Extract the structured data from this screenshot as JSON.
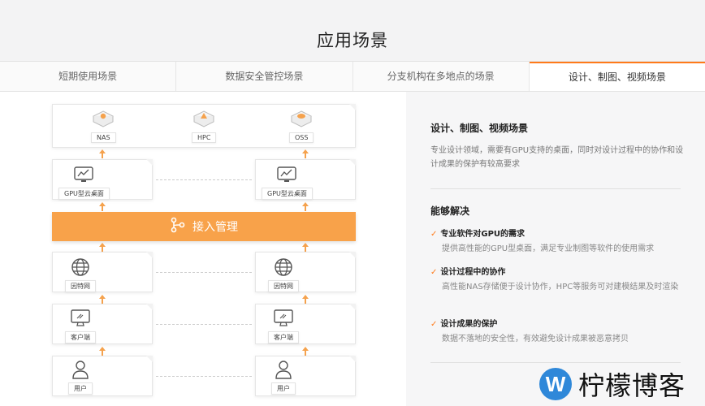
{
  "page": {
    "title": "应用场景"
  },
  "tabs": [
    {
      "label": "短期使用场景"
    },
    {
      "label": "数据安全管控场景"
    },
    {
      "label": "分支机构在多地点的场景"
    },
    {
      "label": "设计、制图、视频场景",
      "active": true
    }
  ],
  "diagram": {
    "storage": {
      "nas": "NAS",
      "hpc": "HPC",
      "oss": "OSS"
    },
    "gpu_left": "GPU型云桌面",
    "gpu_right": "GPU型云桌面",
    "access": "接入管理",
    "internet_left": "因特网",
    "internet_right": "因特网",
    "client_left": "客户端",
    "client_right": "客户端",
    "user_left": "用户",
    "user_right": "用户",
    "colors": {
      "accent": "#ff7a1a",
      "banner": "#f8a24a",
      "arrow": "#f5a24d"
    }
  },
  "panel": {
    "heading": "设计、制图、视频场景",
    "description": "专业设计领域，需要有GPU支持的桌面，同时对设计过程中的协作和设计成果的保护有较高要求",
    "solve_heading": "能够解决",
    "items": [
      {
        "title": "专业软件对GPU的需求",
        "text": "提供高性能的GPU型桌面，满足专业制图等软件的使用需求"
      },
      {
        "title": "设计过程中的协作",
        "text": "高性能NAS存储便于设计协作，HPC等服务可对建模结果及时渲染"
      },
      {
        "title": "设计成果的保护",
        "text": "数据不落地的安全性，有效避免设计成果被恶意拷贝"
      }
    ],
    "check_glyph": "✓"
  },
  "watermark": {
    "logo_letter": "W",
    "text": "柠檬博客"
  }
}
